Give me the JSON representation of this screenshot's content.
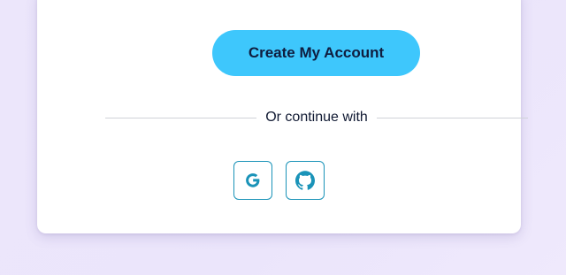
{
  "signup": {
    "submit_label": "Create My Account",
    "divider_text": "Or continue with",
    "social_buttons": [
      {
        "provider": "google",
        "icon": "google-icon"
      },
      {
        "provider": "github",
        "icon": "github-icon"
      }
    ]
  },
  "colors": {
    "accent": "#3ec7fc",
    "social_icon": "#1a93b8",
    "button_text": "#0f1d3f",
    "background": "#ece6fb"
  }
}
